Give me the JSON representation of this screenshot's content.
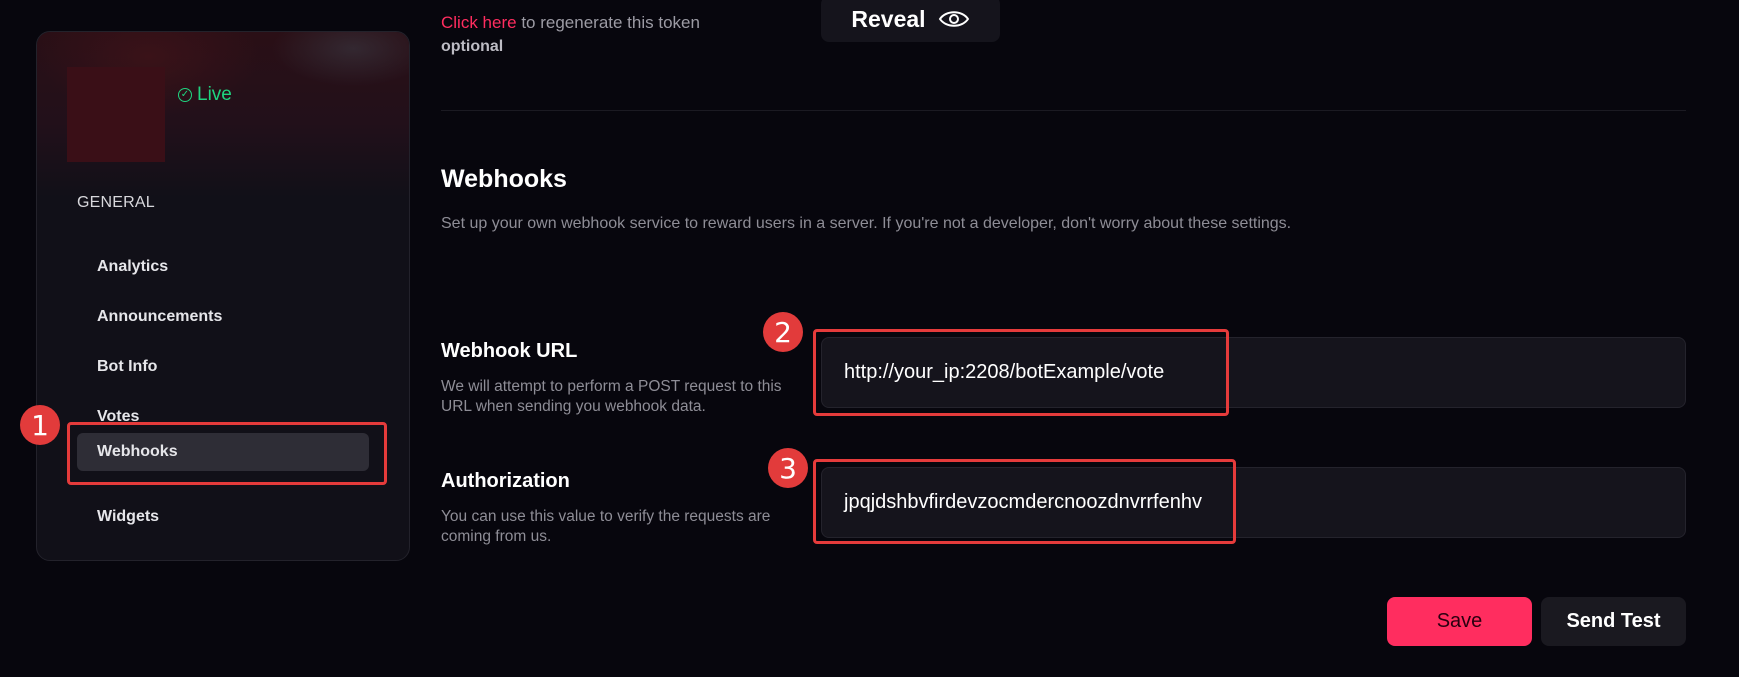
{
  "sidebar": {
    "status": "Live",
    "section": "GENERAL",
    "items": [
      {
        "label": "Analytics"
      },
      {
        "label": "Announcements"
      },
      {
        "label": "Bot Info"
      },
      {
        "label": "Votes"
      },
      {
        "label": "Webhooks",
        "active": true
      },
      {
        "label": "Widgets"
      }
    ]
  },
  "token": {
    "link_text": "Click here",
    "note_suffix": " to regenerate this token",
    "optional": "optional",
    "reveal_label": "Reveal"
  },
  "webhooks": {
    "title": "Webhooks",
    "description": "Set up your own webhook service to reward users in a server. If you're not a developer, don't worry about these settings.",
    "url": {
      "title": "Webhook URL",
      "description": "We will attempt to perform a POST request to this URL when sending you webhook data.",
      "value": "http://your_ip:2208/botExample/vote"
    },
    "authorization": {
      "title": "Authorization",
      "description": "You can use this value to verify the requests are coming from us.",
      "value": "jpqjdshbvfirdevzocmdercnoozdnvrrfenhv"
    }
  },
  "actions": {
    "save_label": "Save",
    "test_label": "Send Test"
  },
  "markers": [
    "1",
    "2",
    "3"
  ],
  "colors": {
    "accent": "#ff2d5f",
    "live": "#1fd47f",
    "annotation": "#e53b3b"
  }
}
